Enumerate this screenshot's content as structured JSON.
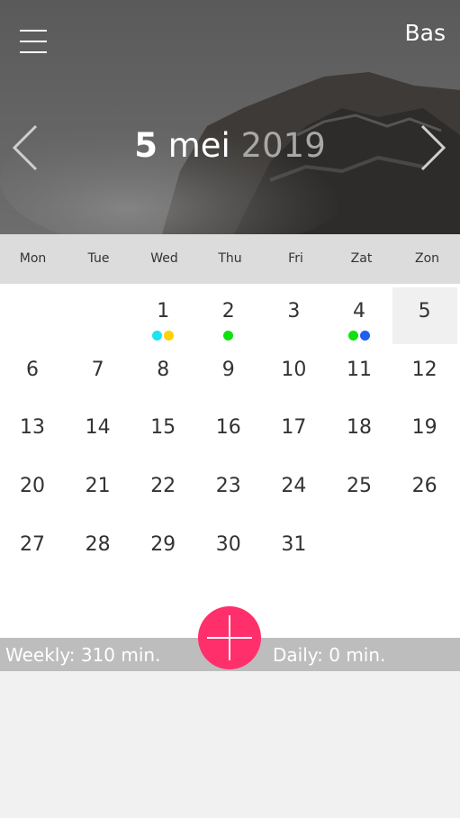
{
  "header": {
    "user_name": "Bas",
    "date_day": "5",
    "date_month": "mei",
    "date_year": "2019"
  },
  "weekdays": [
    "Mon",
    "Tue",
    "Wed",
    "Thu",
    "Fri",
    "Zat",
    "Zon"
  ],
  "calendar": {
    "selected_day": "5",
    "days": [
      {
        "label": "1",
        "col": 2,
        "row": 0,
        "dots": [
          "#1ee3f0",
          "#ffd200"
        ]
      },
      {
        "label": "2",
        "col": 3,
        "row": 0,
        "dots": [
          "#10e010"
        ]
      },
      {
        "label": "3",
        "col": 4,
        "row": 0,
        "dots": []
      },
      {
        "label": "4",
        "col": 5,
        "row": 0,
        "dots": [
          "#10e010",
          "#2060f0"
        ]
      },
      {
        "label": "5",
        "col": 6,
        "row": 0,
        "dots": [],
        "selected": true
      },
      {
        "label": "6",
        "col": 0,
        "row": 1,
        "dots": []
      },
      {
        "label": "7",
        "col": 1,
        "row": 1,
        "dots": []
      },
      {
        "label": "8",
        "col": 2,
        "row": 1,
        "dots": []
      },
      {
        "label": "9",
        "col": 3,
        "row": 1,
        "dots": []
      },
      {
        "label": "10",
        "col": 4,
        "row": 1,
        "dots": []
      },
      {
        "label": "11",
        "col": 5,
        "row": 1,
        "dots": []
      },
      {
        "label": "12",
        "col": 6,
        "row": 1,
        "dots": []
      },
      {
        "label": "13",
        "col": 0,
        "row": 2,
        "dots": []
      },
      {
        "label": "14",
        "col": 1,
        "row": 2,
        "dots": []
      },
      {
        "label": "15",
        "col": 2,
        "row": 2,
        "dots": []
      },
      {
        "label": "16",
        "col": 3,
        "row": 2,
        "dots": []
      },
      {
        "label": "17",
        "col": 4,
        "row": 2,
        "dots": []
      },
      {
        "label": "18",
        "col": 5,
        "row": 2,
        "dots": []
      },
      {
        "label": "19",
        "col": 6,
        "row": 2,
        "dots": []
      },
      {
        "label": "20",
        "col": 0,
        "row": 3,
        "dots": []
      },
      {
        "label": "21",
        "col": 1,
        "row": 3,
        "dots": []
      },
      {
        "label": "22",
        "col": 2,
        "row": 3,
        "dots": []
      },
      {
        "label": "23",
        "col": 3,
        "row": 3,
        "dots": []
      },
      {
        "label": "24",
        "col": 4,
        "row": 3,
        "dots": []
      },
      {
        "label": "25",
        "col": 5,
        "row": 3,
        "dots": []
      },
      {
        "label": "26",
        "col": 6,
        "row": 3,
        "dots": []
      },
      {
        "label": "27",
        "col": 0,
        "row": 4,
        "dots": []
      },
      {
        "label": "28",
        "col": 1,
        "row": 4,
        "dots": []
      },
      {
        "label": "29",
        "col": 2,
        "row": 4,
        "dots": []
      },
      {
        "label": "30",
        "col": 3,
        "row": 4,
        "dots": []
      },
      {
        "label": "31",
        "col": 4,
        "row": 4,
        "dots": []
      }
    ]
  },
  "stats": {
    "weekly": "Weekly:  310 min.",
    "daily": "Daily:  0 min."
  },
  "icons": {
    "menu": "hamburger-menu-icon",
    "prev": "chevron-left-icon",
    "next": "chevron-right-icon",
    "add": "plus-icon"
  },
  "colors": {
    "accent": "#ff2f6c",
    "weekday_bar": "#dcdcdc",
    "stats_bar": "#bdbdbd"
  }
}
